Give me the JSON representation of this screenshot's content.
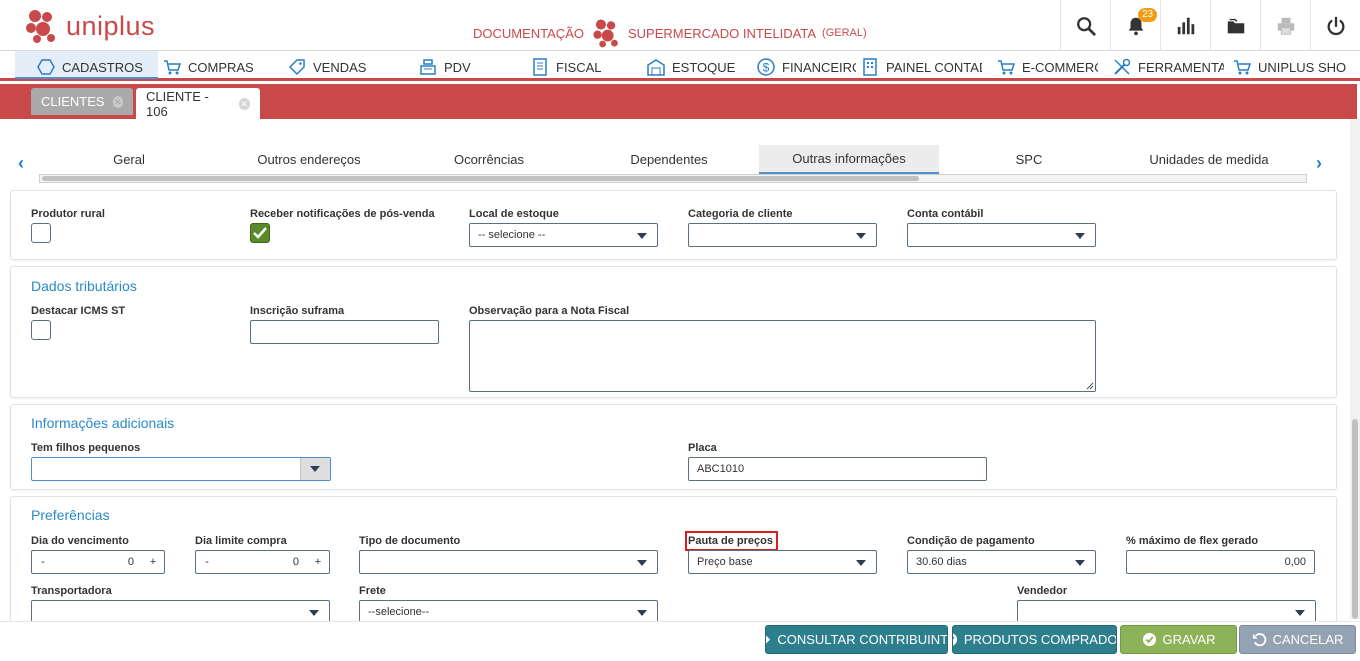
{
  "header": {
    "logo_text": "uniplus",
    "doc_label": "DOCUMENTAÇÃO",
    "company": "SUPERMERCADO INTELIDATA",
    "company_suffix": "(GERAL)",
    "notification_count": "23",
    "icons": [
      "search-icon",
      "bell-icon",
      "bar-chart-icon",
      "folder-icon",
      "printer-icon",
      "power-icon"
    ]
  },
  "menu": {
    "items": [
      {
        "label": "CADASTROS",
        "icon": "hexagon-icon"
      },
      {
        "label": "COMPRAS",
        "icon": "cart-icon"
      },
      {
        "label": "VENDAS",
        "icon": "tag-icon"
      },
      {
        "label": "PDV",
        "icon": "register-icon"
      },
      {
        "label": "FISCAL",
        "icon": "document-icon"
      },
      {
        "label": "ESTOQUE",
        "icon": "warehouse-icon"
      },
      {
        "label": "FINANCEIRO",
        "icon": "dollar-icon"
      },
      {
        "label": "PAINEL CONTADOR",
        "icon": "building-icon"
      },
      {
        "label": "E-COMMERCE",
        "icon": "cart-icon"
      },
      {
        "label": "FERRAMENTAS",
        "icon": "tools-icon"
      },
      {
        "label": "UNIPLUS SHOP",
        "icon": "cart-icon"
      }
    ]
  },
  "doc_tabs": [
    {
      "label": "CLIENTES"
    },
    {
      "label": "CLIENTE - 106"
    }
  ],
  "inner_tabs": [
    "Geral",
    "Outros endereços",
    "Ocorrências",
    "Dependentes",
    "Outras informações",
    "SPC",
    "Unidades de medida"
  ],
  "section1": {
    "produtor_rural": "Produtor rural",
    "receber_notificacoes": "Receber notificações de pós-venda",
    "local_estoque": "Local de estoque",
    "local_estoque_value": "-- selecione --",
    "categoria_cliente": "Categoria de cliente",
    "conta_contabil": "Conta contábil"
  },
  "dados_tributarios": {
    "title": "Dados tributários",
    "destacar_icms": "Destacar ICMS ST",
    "inscricao_suframa": "Inscrição suframa",
    "observacao": "Observação para a Nota Fiscal"
  },
  "info_adicionais": {
    "title": "Informações adicionais",
    "tem_filhos": "Tem filhos pequenos",
    "placa": "Placa",
    "placa_value": "ABC1010"
  },
  "preferencias": {
    "title": "Preferências",
    "dia_vencimento": "Dia do vencimento",
    "dia_vencimento_value": "0",
    "dia_limite": "Dia limite compra",
    "dia_limite_value": "0",
    "tipo_documento": "Tipo de documento",
    "pauta_precos": "Pauta de preços",
    "pauta_precos_value": "Preço base",
    "condicao_pagamento": "Condição de pagamento",
    "condicao_pagamento_value": "30.60 dias",
    "flex_gerado": "% máximo de flex gerado",
    "flex_gerado_value": "0,00",
    "transportadora": "Transportadora",
    "frete": "Frete",
    "frete_value": "--selecione--",
    "vendedor": "Vendedor",
    "minus": "-",
    "plus": "+"
  },
  "footer": {
    "consultar": "CONSULTAR CONTRIBUINTE",
    "produtos": "PRODUTOS COMPRADOS",
    "gravar": "GRAVAR",
    "cancelar": "CANCELAR"
  },
  "colors": {
    "brand_red": "#c9494b",
    "accent_blue": "#2a8ac9",
    "teal_button": "#2e7f8e",
    "green_button": "#8cb357",
    "gray_button": "#94a3b4"
  }
}
